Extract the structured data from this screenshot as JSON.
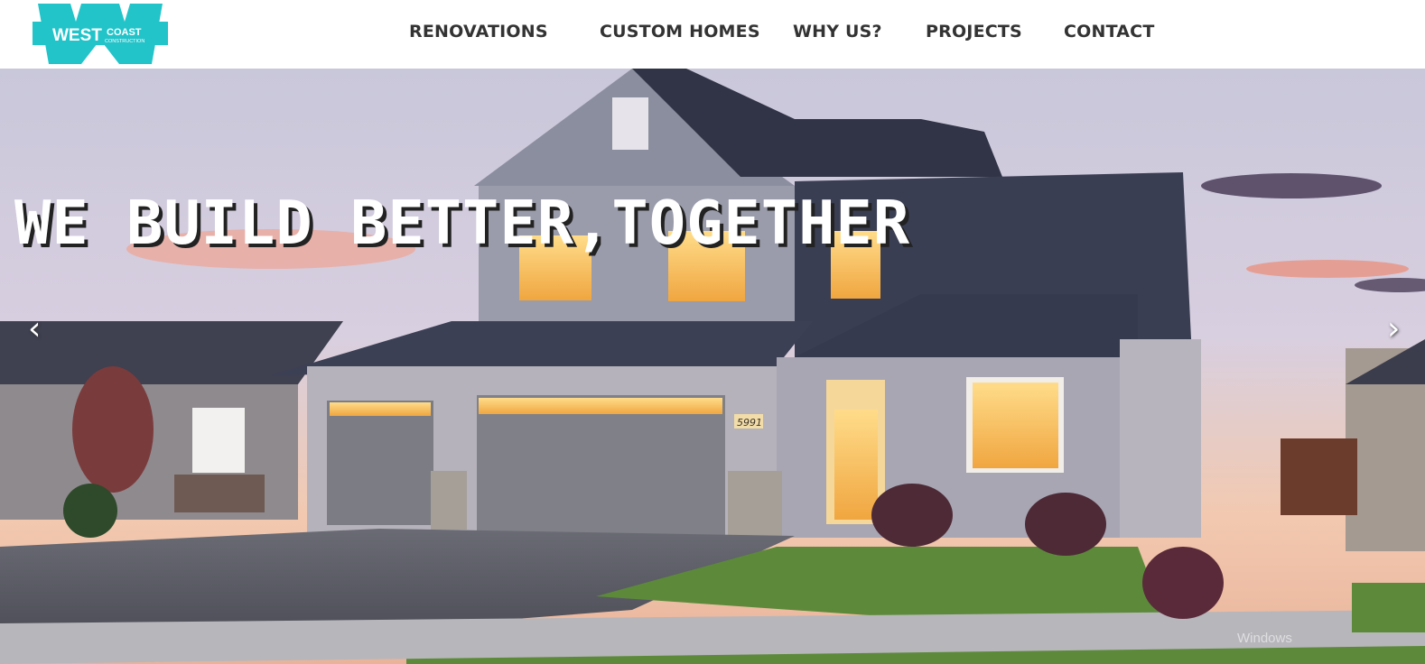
{
  "brand": {
    "logo_line1": "WEST",
    "logo_line2": "COAST",
    "logo_line3": "CONSTRUCTION",
    "color": "#22c4c9"
  },
  "nav": {
    "items": [
      {
        "label": "RENOVATIONS"
      },
      {
        "label": "CUSTOM HOMES"
      },
      {
        "label": "WHY US?"
      },
      {
        "label": "PROJECTS"
      },
      {
        "label": "CONTACT"
      }
    ]
  },
  "hero": {
    "headline": "WE BUILD BETTER,TOGETHER",
    "prev_icon": "‹",
    "next_icon": "›",
    "house_number": "5991",
    "watermark": "Windows"
  }
}
